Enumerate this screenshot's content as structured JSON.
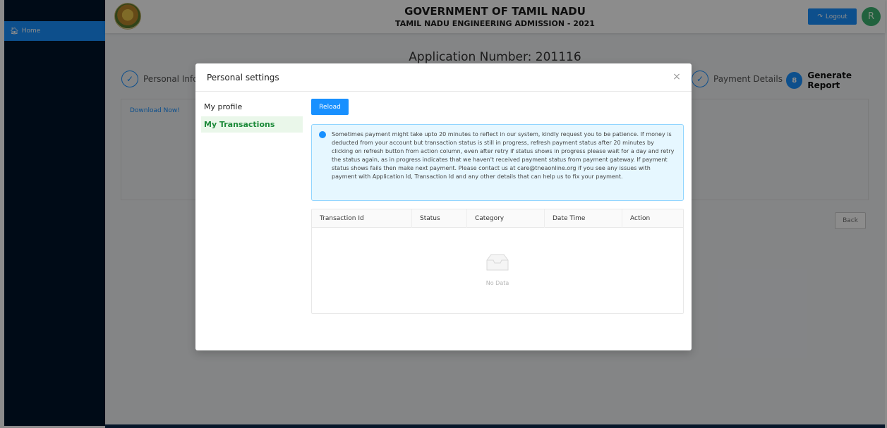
{
  "sidebar": {
    "home_label": "Home"
  },
  "header": {
    "title": "GOVERNMENT OF TAMIL NADU",
    "subtitle": "TAMIL NADU ENGINEERING ADMISSION - 2021",
    "logout_label": "Logout",
    "avatar_glyph": "R"
  },
  "main": {
    "application_number": "Application Number: 201116",
    "steps": [
      {
        "label": "Personal Info",
        "mark": "✓"
      },
      {
        "label": "Payment Details",
        "mark": "✓"
      },
      {
        "label": "Generate Report",
        "mark": "8"
      }
    ],
    "download_link": "Download Now!",
    "back_label": "Back"
  },
  "modal": {
    "title": "Personal settings",
    "close_glyph": "×",
    "menu": [
      {
        "label": "My profile"
      },
      {
        "label": "My Transactions"
      }
    ],
    "reload_label": "Reload",
    "info_text": "Sometimes payment might take upto 20 minutes to reflect in our system, kindly request you to be patience. If money is deducted from your account but transaction status is still in progress, refresh payment status after 20 minutes by clicking on refresh button from action column, even after retry if status shows in progress please wait for a day and retry the status again, as in progress indicates that we haven't received payment status from payment gateway. If payment status shows fails then make next payment. Please contact us at care@tneaonline.org if you see any issues with payment with Application Id, Transaction Id and any other details that can help us to fix your payment.",
    "table": {
      "columns": [
        "Transaction Id",
        "Status",
        "Category",
        "Date Time",
        "Action"
      ],
      "empty_text": "No Data"
    }
  },
  "colors": {
    "primary": "#1890ff",
    "sidebar": "#00152a",
    "accent_green": "#3cb371"
  }
}
